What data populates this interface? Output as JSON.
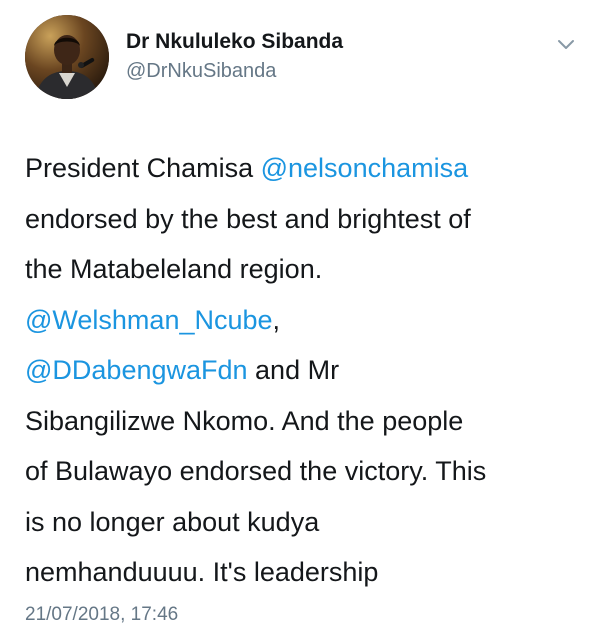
{
  "colors": {
    "text": "#14171a",
    "secondary": "#657786",
    "link": "#1b95e0",
    "background": "#ffffff"
  },
  "author": {
    "name": "Dr Nkululeko Sibanda",
    "handle": "@DrNkuSibanda",
    "avatar_icon": "profile-photo"
  },
  "menu_icon": "chevron-down-icon",
  "tweet": {
    "lines": [
      {
        "before": "President Chamisa ",
        "mention": "@nelsonchamisa",
        "after": ""
      },
      {
        "before": "endorsed by the best and brightest of",
        "mention": "",
        "after": ""
      },
      {
        "before": "the Matabeleland region.",
        "mention": "",
        "after": ""
      },
      {
        "before": "",
        "mention": "@Welshman_Ncube",
        "after": ","
      },
      {
        "before": "",
        "mention": "@DDabengwaFdn",
        "after": " and Mr"
      },
      {
        "before": "Sibangilizwe Nkomo. And the people",
        "mention": "",
        "after": ""
      },
      {
        "before": "of Bulawayo endorsed the victory. This",
        "mention": "",
        "after": ""
      },
      {
        "before": "is no longer about kudya",
        "mention": "",
        "after": ""
      },
      {
        "before": "nemhanduuuu. It's leadership",
        "mention": "",
        "after": ""
      }
    ],
    "timestamp": "21/07/2018, 17:46"
  }
}
